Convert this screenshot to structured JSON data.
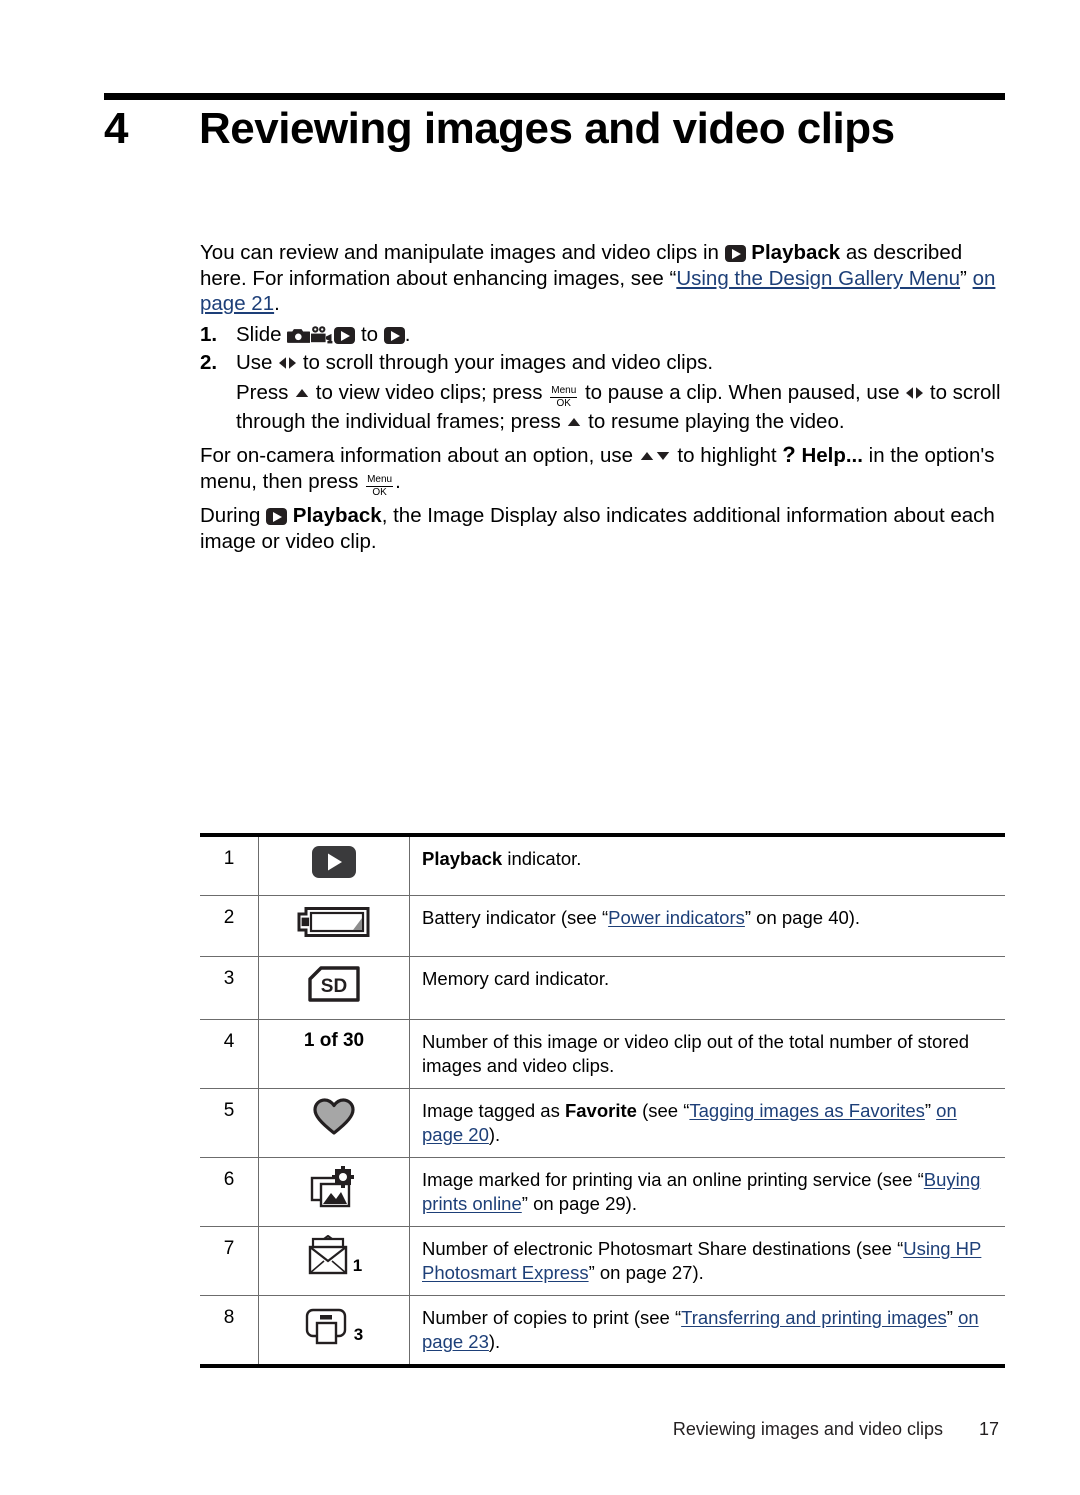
{
  "chapter": {
    "number": "4",
    "title": "Reviewing images and video clips"
  },
  "intro": {
    "part1": "You can review and manipulate images and video clips in ",
    "playback_label": "Playback",
    "part2": " as described here. For information about enhancing images, see “",
    "link_text": "Using the Design Gallery Menu",
    "part3": "” ",
    "link_page_text": "on page 21",
    "part4": "."
  },
  "steps": [
    {
      "number": "1.",
      "text_before": "Slide ",
      "icons": [
        "camera-icon",
        "video-camera-icon",
        "playback-icon"
      ],
      "text_middle": " to ",
      "icon_after": "playback-icon",
      "text_after": "."
    },
    {
      "number": "2.",
      "text_before": "Use ",
      "icon": "left-right-arrows-icon",
      "text_after": " to scroll through your images and video clips.",
      "sub": {
        "s1": "Press ",
        "s2": " to view video clips; press ",
        "menu_ok": {
          "top": "Menu",
          "bottom": "OK"
        },
        "s3": " to pause a clip. When paused, use ",
        "s4": " to scroll through the individual frames; press ",
        "s5": " to resume playing the video."
      }
    }
  ],
  "paragraph_oncamera": {
    "part1": "For on-camera information about an option, use ",
    "part2": " to highlight ",
    "help_label": "Help...",
    "part3": " in the option's menu, then press ",
    "menu_ok": {
      "top": "Menu",
      "bottom": "OK"
    },
    "part4": "."
  },
  "paragraph_during": {
    "part1": "During ",
    "playback_label": "Playback",
    "part2": ", the Image Display also indicates additional information about each image or video clip."
  },
  "table": {
    "rows": [
      {
        "number": "1",
        "icon": "playback-indicator-icon",
        "icon_label": "",
        "desc_bold": "Playback",
        "desc_rest": " indicator."
      },
      {
        "number": "2",
        "icon": "battery-indicator-icon",
        "icon_label": "",
        "desc_pre": "Battery indicator (see “",
        "link": "Power indicators",
        "desc_post": "” on page 40)."
      },
      {
        "number": "3",
        "icon": "sd-card-icon",
        "icon_label": "",
        "desc_plain": "Memory card indicator."
      },
      {
        "number": "4",
        "icon": "image-count-text",
        "icon_label": "1 of 30",
        "desc_plain": "Number of this image or video clip out of the total number of stored images and video clips."
      },
      {
        "number": "5",
        "icon": "favorite-heart-icon",
        "icon_label": "",
        "desc_pre": "Image tagged as ",
        "desc_bold": "Favorite",
        "desc_mid": " (see “",
        "link": "Tagging images as Favorites",
        "desc_post_quote": "” ",
        "link2": "on page 20",
        "desc_post": ")."
      },
      {
        "number": "6",
        "icon": "online-print-order-icon",
        "icon_label": "",
        "desc_pre": "Image marked for printing via an online printing service (see “",
        "link": "Buying prints online",
        "desc_post_quote": "” on page 29",
        "desc_post": ")."
      },
      {
        "number": "7",
        "icon": "share-envelope-icon",
        "icon_label": "1",
        "desc_pre": "Number of electronic Photosmart Share destinations (see “",
        "link": "Using HP Photosmart Express",
        "desc_post_quote": "” on page 27",
        "desc_post": ")."
      },
      {
        "number": "8",
        "icon": "printer-copies-icon",
        "icon_label": "3",
        "desc_pre": "Number of copies to print (see “",
        "link": "Transferring and printing images",
        "desc_post_quote": "” ",
        "link2": "on page 23",
        "desc_post": ")."
      }
    ]
  },
  "footer": {
    "title": "Reviewing images and video clips",
    "page": "17"
  },
  "colors": {
    "link": "#1d3f78",
    "text": "#000000",
    "rule": "#000000",
    "table_divider": "#6c6c6c",
    "heart_fill": "#a6a6a6"
  }
}
